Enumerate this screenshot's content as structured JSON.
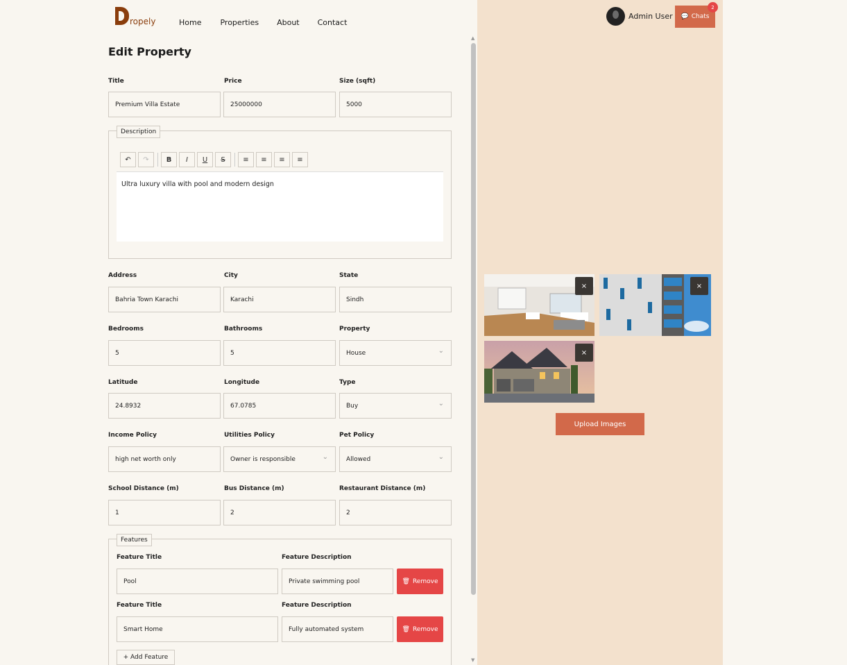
{
  "nav": {
    "logo_text": "ropely",
    "items": [
      "Home",
      "Properties",
      "About",
      "Contact"
    ]
  },
  "header": {
    "user_name": "Admin User",
    "chats_label": "Chats",
    "chats_badge": "2"
  },
  "form": {
    "title": "Edit Property",
    "fields": {
      "title": {
        "label": "Title",
        "value": "Premium Villa Estate"
      },
      "price": {
        "label": "Price",
        "value": "25000000"
      },
      "size": {
        "label": "Size (sqft)",
        "value": "5000"
      },
      "address": {
        "label": "Address",
        "value": "Bahria Town Karachi"
      },
      "city": {
        "label": "City",
        "value": "Karachi"
      },
      "state": {
        "label": "State",
        "value": "Sindh"
      },
      "bedrooms": {
        "label": "Bedrooms",
        "value": "5"
      },
      "bathrooms": {
        "label": "Bathrooms",
        "value": "5"
      },
      "property": {
        "label": "Property",
        "value": "House"
      },
      "latitude": {
        "label": "Latitude",
        "value": "24.8932"
      },
      "longitude": {
        "label": "Longitude",
        "value": "67.0785"
      },
      "type": {
        "label": "Type",
        "value": "Buy"
      },
      "income": {
        "label": "Income Policy",
        "value": "high net worth only"
      },
      "utilities": {
        "label": "Utilities Policy",
        "value": "Owner is responsible"
      },
      "pet": {
        "label": "Pet Policy",
        "value": "Allowed"
      },
      "school": {
        "label": "School Distance (m)",
        "value": "1"
      },
      "bus": {
        "label": "Bus Distance (m)",
        "value": "2"
      },
      "restaurant": {
        "label": "Restaurant Distance (m)",
        "value": "2"
      }
    },
    "description": {
      "legend": "Description",
      "text": "Ultra luxury villa with pool and modern design"
    },
    "features": {
      "legend": "Features",
      "title_label": "Feature Title",
      "desc_label": "Feature Description",
      "remove_label": "Remove",
      "add_label": "+ Add Feature",
      "items": [
        {
          "title": "Pool",
          "description": "Private swimming pool"
        },
        {
          "title": "Smart Home",
          "description": "Fully automated system"
        }
      ]
    }
  },
  "images": {
    "upload_label": "Upload Images",
    "remove_symbol": "×"
  }
}
